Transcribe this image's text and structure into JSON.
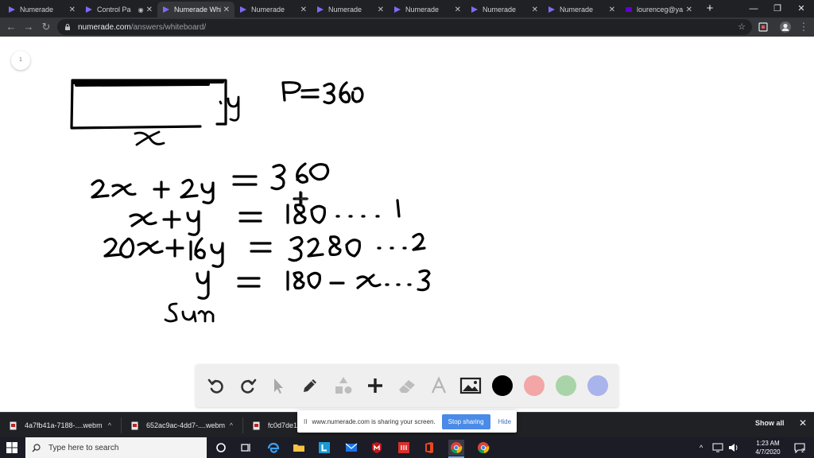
{
  "browser": {
    "tabs": [
      {
        "title": "Numerade",
        "active": false
      },
      {
        "title": "Control Pa",
        "active": false
      },
      {
        "title": "Numerade Whi",
        "active": true
      },
      {
        "title": "Numerade",
        "active": false
      },
      {
        "title": "Numerade",
        "active": false
      },
      {
        "title": "Numerade",
        "active": false
      },
      {
        "title": "Numerade",
        "active": false
      },
      {
        "title": "Numerade",
        "active": false
      },
      {
        "title": "lourenceg@ya",
        "active": false
      }
    ],
    "new_tab_label": "+",
    "url_host": "numerade.com",
    "url_path": "/answers/whiteboard/"
  },
  "whiteboard": {
    "page_number": "1",
    "tools": [
      "undo-icon",
      "redo-icon",
      "pointer-icon",
      "pencil-icon",
      "shapes-icon",
      "plus-icon",
      "eraser-icon",
      "text-icon",
      "image-icon"
    ],
    "colors": [
      "#000000",
      "#f2a6a6",
      "#a9d4a9",
      "#a9b3ec"
    ],
    "selected_color": "#000000"
  },
  "downloads": {
    "items": [
      {
        "name": "4a7fb41a-7188-....webm"
      },
      {
        "name": "652ac9ac-4dd7-....webm"
      },
      {
        "name": "fc0d7de1-9"
      }
    ],
    "show_all_label": "Show all"
  },
  "share_banner": {
    "message": "www.numerade.com is sharing your screen.",
    "stop_label": "Stop sharing",
    "hide_label": "Hide"
  },
  "taskbar": {
    "search_placeholder": "Type here to search",
    "time": "1:23 AM",
    "date": "4/7/2020",
    "notification_count": "2"
  }
}
